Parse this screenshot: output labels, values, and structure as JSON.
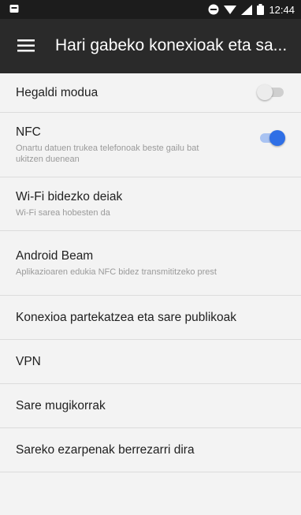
{
  "status_bar": {
    "time": "12:44",
    "icons": [
      "notification-icon",
      "do-not-disturb-icon",
      "wifi-icon",
      "signal-icon",
      "battery-icon"
    ]
  },
  "app_bar": {
    "title": "Hari gabeko konexioak eta sa...",
    "menu_icon": "hamburger-menu-icon"
  },
  "settings": {
    "airplane": {
      "title": "Hegaldi modua",
      "toggle": "off"
    },
    "nfc": {
      "title": "NFC",
      "subtitle": "Onartu datuen trukea telefonoak beste gailu bat ukitzen duenean",
      "toggle": "on"
    },
    "wifi_calling": {
      "title": "Wi-Fi bidezko deiak",
      "subtitle": "Wi-Fi sarea hobesten da"
    },
    "android_beam": {
      "title": "Android Beam",
      "subtitle": "Aplikazioaren edukia NFC bidez transmititzeko prest"
    },
    "tethering": {
      "title": "Konexioa partekatzea eta sare publikoak"
    },
    "vpn": {
      "title": "VPN"
    },
    "mobile_networks": {
      "title": "Sare mugikorrak"
    },
    "network_reset": {
      "title": "Sareko ezarpenak berrezarri dira"
    }
  },
  "colors": {
    "accent": "#2f6fe6",
    "app_bar": "#2a2a2a",
    "status_bar": "#1c1c1c",
    "background": "#f3f3f3"
  }
}
